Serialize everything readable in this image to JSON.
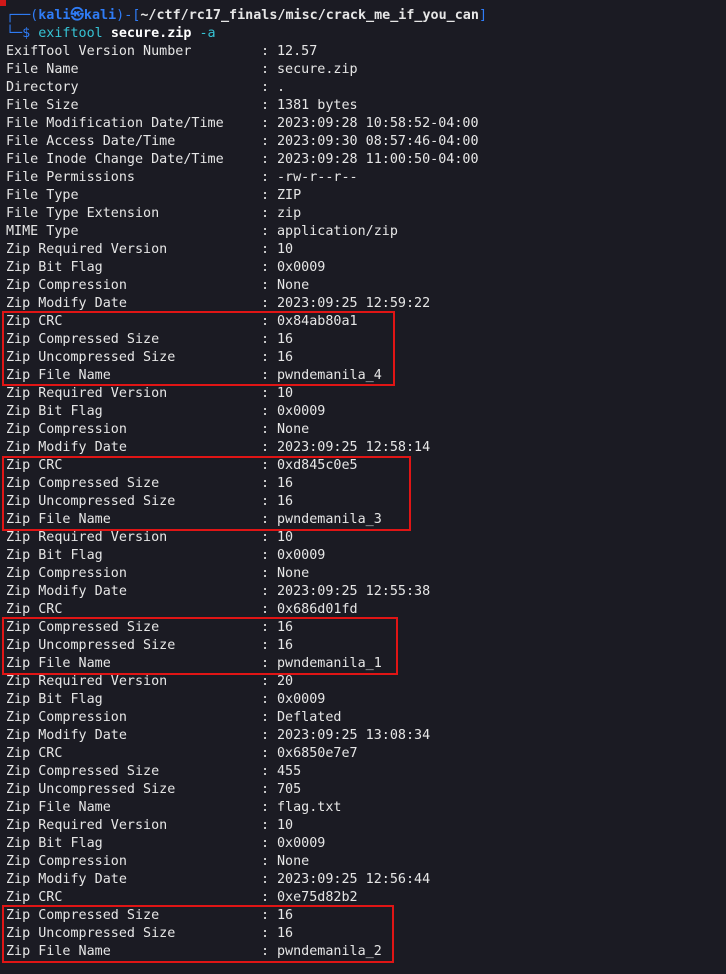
{
  "prompt": {
    "box_top": "┌──(",
    "user": "kali㉿kali",
    "bracket_mid": ")-[",
    "path": "~/ctf/rc17_finals/misc/crack_me_if_you_can",
    "bracket_end": "]",
    "box_bottom": "└─",
    "dollar": "$",
    "command": "exiftool",
    "argument": "secure.zip",
    "flag": "-a"
  },
  "rows": [
    {
      "key": "ExifTool Version Number",
      "value": "12.57"
    },
    {
      "key": "File Name",
      "value": "secure.zip"
    },
    {
      "key": "Directory",
      "value": "."
    },
    {
      "key": "File Size",
      "value": "1381 bytes"
    },
    {
      "key": "File Modification Date/Time",
      "value": "2023:09:28 10:58:52-04:00"
    },
    {
      "key": "File Access Date/Time",
      "value": "2023:09:30 08:57:46-04:00"
    },
    {
      "key": "File Inode Change Date/Time",
      "value": "2023:09:28 11:00:50-04:00"
    },
    {
      "key": "File Permissions",
      "value": "-rw-r--r--"
    },
    {
      "key": "File Type",
      "value": "ZIP"
    },
    {
      "key": "File Type Extension",
      "value": "zip"
    },
    {
      "key": "MIME Type",
      "value": "application/zip"
    },
    {
      "key": "Zip Required Version",
      "value": "10"
    },
    {
      "key": "Zip Bit Flag",
      "value": "0x0009"
    },
    {
      "key": "Zip Compression",
      "value": "None"
    },
    {
      "key": "Zip Modify Date",
      "value": "2023:09:25 12:59:22"
    },
    {
      "key": "Zip CRC",
      "value": "0x84ab80a1"
    },
    {
      "key": "Zip Compressed Size",
      "value": "16"
    },
    {
      "key": "Zip Uncompressed Size",
      "value": "16"
    },
    {
      "key": "Zip File Name",
      "value": "pwndemanila_4"
    },
    {
      "key": "Zip Required Version",
      "value": "10"
    },
    {
      "key": "Zip Bit Flag",
      "value": "0x0009"
    },
    {
      "key": "Zip Compression",
      "value": "None"
    },
    {
      "key": "Zip Modify Date",
      "value": "2023:09:25 12:58:14"
    },
    {
      "key": "Zip CRC",
      "value": "0xd845c0e5"
    },
    {
      "key": "Zip Compressed Size",
      "value": "16"
    },
    {
      "key": "Zip Uncompressed Size",
      "value": "16"
    },
    {
      "key": "Zip File Name",
      "value": "pwndemanila_3"
    },
    {
      "key": "Zip Required Version",
      "value": "10"
    },
    {
      "key": "Zip Bit Flag",
      "value": "0x0009"
    },
    {
      "key": "Zip Compression",
      "value": "None"
    },
    {
      "key": "Zip Modify Date",
      "value": "2023:09:25 12:55:38"
    },
    {
      "key": "Zip CRC",
      "value": "0x686d01fd"
    },
    {
      "key": "Zip Compressed Size",
      "value": "16"
    },
    {
      "key": "Zip Uncompressed Size",
      "value": "16"
    },
    {
      "key": "Zip File Name",
      "value": "pwndemanila_1"
    },
    {
      "key": "Zip Required Version",
      "value": "20"
    },
    {
      "key": "Zip Bit Flag",
      "value": "0x0009"
    },
    {
      "key": "Zip Compression",
      "value": "Deflated"
    },
    {
      "key": "Zip Modify Date",
      "value": "2023:09:25 13:08:34"
    },
    {
      "key": "Zip CRC",
      "value": "0x6850e7e7"
    },
    {
      "key": "Zip Compressed Size",
      "value": "455"
    },
    {
      "key": "Zip Uncompressed Size",
      "value": "705"
    },
    {
      "key": "Zip File Name",
      "value": "flag.txt"
    },
    {
      "key": "Zip Required Version",
      "value": "10"
    },
    {
      "key": "Zip Bit Flag",
      "value": "0x0009"
    },
    {
      "key": "Zip Compression",
      "value": "None"
    },
    {
      "key": "Zip Modify Date",
      "value": "2023:09:25 12:56:44"
    },
    {
      "key": "Zip CRC",
      "value": "0xe75d82b2"
    },
    {
      "key": "Zip Compressed Size",
      "value": "16"
    },
    {
      "key": "Zip Uncompressed Size",
      "value": "16"
    },
    {
      "key": "Zip File Name",
      "value": "pwndemanila_2"
    }
  ],
  "separator": ":",
  "colors": {
    "background": "#1b1b23",
    "text": "#e6e6e6",
    "prompt_blue": "#2f7cf6",
    "command_cyan": "#36c3d4",
    "highlight_red": "#e01515"
  }
}
